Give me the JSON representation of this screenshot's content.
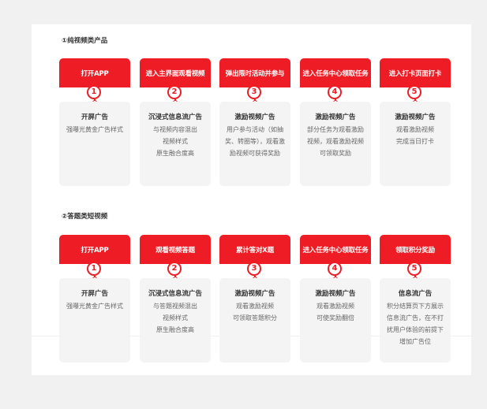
{
  "sections": [
    {
      "title": "①纯视频类产品",
      "steps": [
        {
          "header": "打开APP",
          "num": "1",
          "title": "开屏广告",
          "desc": "强曝光黄金广告样式"
        },
        {
          "header": "进入主界面观看视频",
          "num": "2",
          "title": "沉浸式信息流广告",
          "desc": "与视频内容混出\n视频样式\n原生融合度高"
        },
        {
          "header": "弹出限时活动并参与",
          "num": "3",
          "title": "激励视频广告",
          "desc": "用户参与活动（如抽奖、转圈等），观看激励视频可获得奖励"
        },
        {
          "header": "进入任务中心领取任务",
          "num": "4",
          "title": "激励视频广告",
          "desc": "部分任务为观看激励视频，观看激励视频可领取奖励"
        },
        {
          "header": "进入打卡页面打卡",
          "num": "5",
          "title": "激励视频广告",
          "desc": "观看激励视频\n完成当日打卡"
        }
      ]
    },
    {
      "title": "②答题类短视频",
      "steps": [
        {
          "header": "打开APP",
          "num": "1",
          "title": "开屏广告",
          "desc": "强曝光黄金广告样式"
        },
        {
          "header": "观看视频答题",
          "num": "2",
          "title": "沉浸式信息流广告",
          "desc": "与答题视频混出\n视频样式\n原生融合度高"
        },
        {
          "header": "累计答对X题",
          "num": "3",
          "title": "激励视频广告",
          "desc": "观看激励视频\n可领取答题积分"
        },
        {
          "header": "进入任务中心领取任务",
          "num": "4",
          "title": "激励视频广告",
          "desc": "观看激励视频\n可使奖励翻倍"
        },
        {
          "header": "领取积分奖励",
          "num": "5",
          "title": "信息流广告",
          "desc": "积分结算页下方展示信息流广告，在不打扰用户体验的前提下增加广告位"
        }
      ]
    }
  ]
}
